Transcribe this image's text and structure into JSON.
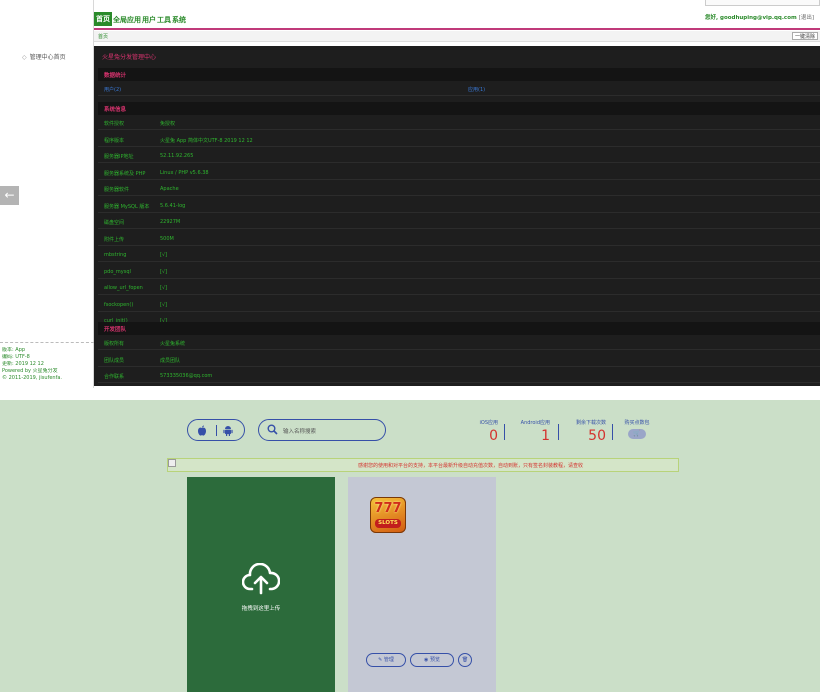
{
  "admin": {
    "nav": [
      "首页",
      "全局",
      "应用",
      "用户",
      "工具",
      "系统"
    ],
    "user": "您好, goodhuping@vip.qq.com",
    "logout": "[退出]",
    "breadcrumb": "首页",
    "cache_button": "一键清除",
    "sidebar_home": "管理中心首页",
    "footer": [
      "版本: App",
      "编码: UTF-8",
      "更新: 2019 12 12",
      "Powered by 火星兔分发",
      "© 2011-2019, jisufenfa."
    ],
    "panel_title": "火星兔分发管理中心",
    "stats_title": "数据统计",
    "stat_users": "用户(2)",
    "stat_apps": "应用(1)",
    "sysinfo_title": "系统信息",
    "sysinfo": [
      {
        "k": "软件授权",
        "v": "免授权"
      },
      {
        "k": "程序版本",
        "v": "火星兔 App 简体中文UTF-8 2019 12 12"
      },
      {
        "k": "服务器IP地址",
        "v": "52.11.92.265"
      },
      {
        "k": "服务器系统及 PHP",
        "v": "Linux / PHP v5.6.38"
      },
      {
        "k": "服务器软件",
        "v": "Apache"
      },
      {
        "k": "服务器 MySQL 版本",
        "v": "5.6.41-log"
      },
      {
        "k": "磁盘空间",
        "v": "22927M"
      },
      {
        "k": "附件上传",
        "v": "500M"
      },
      {
        "k": "mbstring",
        "v": "[√]"
      },
      {
        "k": "pdo_mysql",
        "v": "[√]"
      },
      {
        "k": "allow_url_fopen",
        "v": "[√]"
      },
      {
        "k": "fsockopen()",
        "v": "[√]"
      },
      {
        "k": "curl_init()",
        "v": "[√]"
      }
    ],
    "dev_title": "开发团队",
    "dev": [
      {
        "k": "版权所有",
        "v": "火星兔系统"
      },
      {
        "k": "团队成员",
        "v": "成员团队"
      },
      {
        "k": "合作联系",
        "v": "573335036@qq.com"
      }
    ]
  },
  "bottom": {
    "search_placeholder": "输入名称搜索",
    "counters": [
      {
        "label": "iOS应用",
        "value": "0"
      },
      {
        "label": "Android应用",
        "value": "1"
      },
      {
        "label": "剩余下载次数",
        "value": "50"
      }
    ],
    "buy_label": "购买点数包",
    "notice": "感谢您的使用和对平台的支持，本平台最新升级自动充值次数，自动到账，只有签名封装教程，请查收",
    "upload_text": "拖拽到这里上传",
    "manage_button": "管理",
    "preview_button": "预览"
  },
  "colors": {
    "accent_green": "#2a8a2a",
    "panel_bg": "#1e1e1e",
    "pink": "#d7336e",
    "bottom_bg": "#cbdfc8",
    "upload_card": "#2c6b3b",
    "blue": "#3650a8",
    "red": "#d4332f"
  },
  "icons": [
    "arrow-left-icon",
    "apple-icon",
    "android-icon",
    "search-icon",
    "cart-icon",
    "upload-cloud-icon",
    "pencil-icon",
    "eye-icon",
    "trash-icon",
    "slots-app-icon"
  ]
}
